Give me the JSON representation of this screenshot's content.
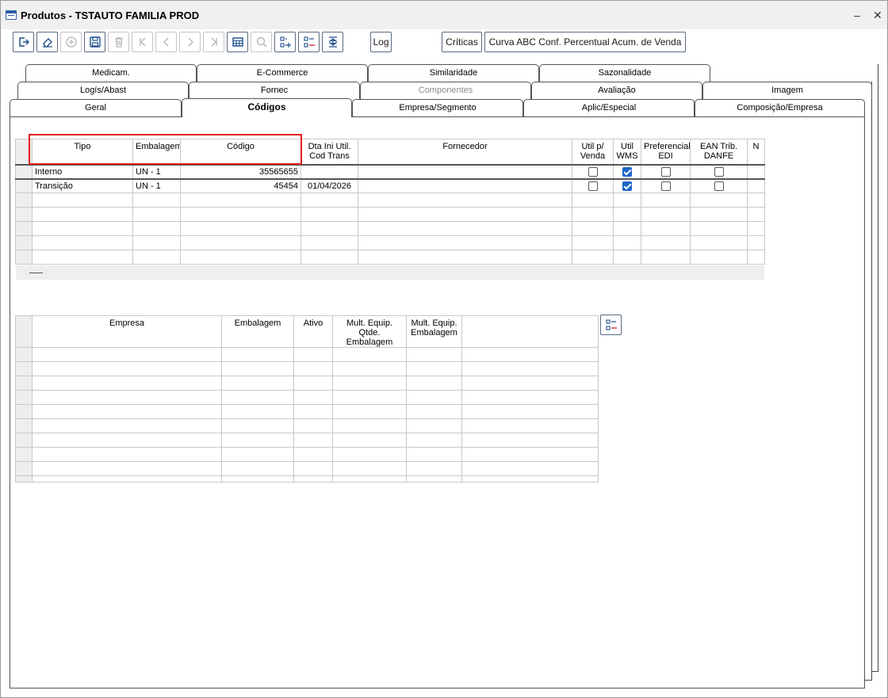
{
  "window": {
    "title": "Produtos - TSTAUTO FAMILIA PROD"
  },
  "toolbar": {
    "log_label": "Log",
    "criticas_label": "Críticas",
    "curva_label": "Curva ABC Conf. Percentual Acum. de Venda"
  },
  "tabs": {
    "row1": [
      "Medicam.",
      "E-Commerce",
      "Similaridade",
      "Sazonalidade"
    ],
    "row2": [
      "Logís/Abast",
      "Fornec",
      "Componentes",
      "Avaliação",
      "Imagem"
    ],
    "row3": [
      "Geral",
      "Códigos",
      "Empresa/Segmento",
      "Aplic/Especial",
      "Composição/Empresa"
    ]
  },
  "codes_grid": {
    "headers": {
      "tipo": "Tipo",
      "embalagem": "Embalagem",
      "codigo": "Código",
      "dta_ini": "Dta Ini Util. Cod Trans",
      "fornecedor": "Fornecedor",
      "util_venda": "Util p/ Venda",
      "util_wms": "Util WMS",
      "preferencial": "Preferencial EDI",
      "ean": "EAN Trib. DANFE",
      "next": "N"
    },
    "rows": [
      {
        "tipo": "Interno",
        "embalagem": "UN - 1",
        "codigo": "35565655",
        "dta_ini": "",
        "fornecedor": "",
        "util_venda": false,
        "util_wms": true,
        "preferencial": false,
        "ean": false
      },
      {
        "tipo": "Transição",
        "embalagem": "UN - 1",
        "codigo": "45454",
        "dta_ini": "01/04/2026",
        "fornecedor": "",
        "util_venda": false,
        "util_wms": true,
        "preferencial": false,
        "ean": false
      }
    ]
  },
  "empresa_grid": {
    "headers": {
      "empresa": "Empresa",
      "embalagem": "Embalagem",
      "ativo": "Ativo",
      "mult_qtde": "Mult. Equip. Qtde. Embalagem",
      "mult_emb": "Mult. Equip. Embalagem"
    }
  }
}
